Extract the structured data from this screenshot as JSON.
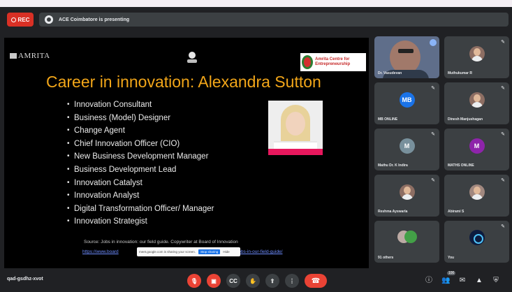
{
  "topbar": {
    "rec_label": "REC",
    "presenting_text": "ACE Coimbatore is presenting"
  },
  "slide": {
    "logo_text": "AMRITA",
    "ace_logo_text": "Amrita Centre for Entrepreneurship",
    "title": "Career in innovation: Alexandra Sutton",
    "bullets": [
      "Innovation Consultant",
      "Business (Model) Designer",
      "Change Agent",
      "Chief Innovation Officer (CIO)",
      "New Business Development Manager",
      "Business Development Lead",
      "Innovation Catalyst",
      "Innovation Analyst",
      "Digital Transformation Officer/ Manager",
      "Innovation Strategist"
    ],
    "source_text": "Source: Jobs in innovation: our field guide. Copywriter at Board of Innovation",
    "link_left": "https://www.board",
    "link_right": "/jobs-in-our-field-guide/",
    "share_bar_text": "meet.google.com is sharing your screen.",
    "share_bar_button": "Stop sharing",
    "share_bar_hide": "Hide"
  },
  "participants": [
    {
      "name": "Dr. Vasudevan",
      "type": "video"
    },
    {
      "name": "Muthukumar R",
      "type": "photo"
    },
    {
      "name": "MB ONLINE",
      "type": "initials",
      "initials": "MB",
      "color": "#1a73e8"
    },
    {
      "name": "Dinesh Manjushagan",
      "type": "photo"
    },
    {
      "name": "Mathu Dr. K Indira",
      "type": "initials",
      "initials": "M",
      "color": "#78909c"
    },
    {
      "name": "MATHS ONLINE",
      "type": "initials",
      "initials": "M",
      "color": "#8e24aa"
    },
    {
      "name": "Reshma Ayswarla",
      "type": "photo"
    },
    {
      "name": "Abirami S",
      "type": "photo"
    },
    {
      "name": "91 others",
      "type": "pair"
    },
    {
      "name": "You",
      "type": "logo"
    }
  ],
  "bottombar": {
    "meeting_code": "qad-gsdhz-xvot",
    "mic_icon": "mic-off-icon",
    "cam_icon": "camera-off-icon",
    "people_count": "100"
  }
}
